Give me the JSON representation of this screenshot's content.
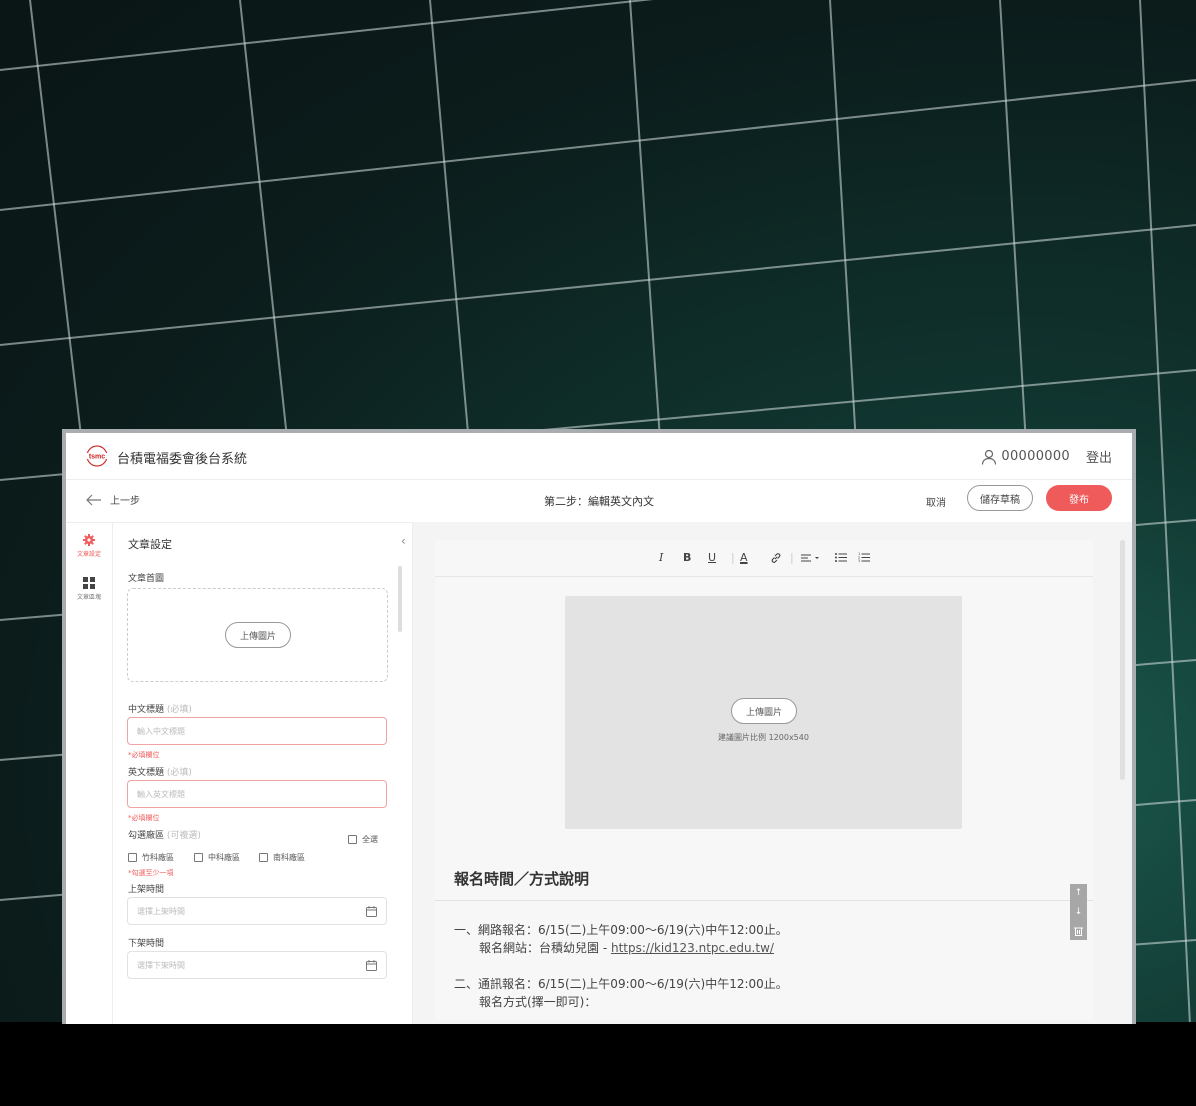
{
  "header": {
    "logo_text": "tsmc",
    "app_title": "台積電福委會後台系統",
    "user_id": "00000000",
    "logout": "登出"
  },
  "subbar": {
    "back": "上一步",
    "step_title": "第二步：編輯英文內文",
    "cancel": "取消",
    "save_draft": "儲存草稿",
    "publish": "發布"
  },
  "rail": {
    "items": [
      {
        "label": "文章設定",
        "icon": "gear-icon",
        "active": true
      },
      {
        "label": "文章區塊",
        "icon": "grid-icon",
        "active": false
      }
    ]
  },
  "panel": {
    "title": "文章設定",
    "cover_label": "文章首圖",
    "upload_btn": "上傳圖片",
    "zh_title_label": "中文標題",
    "required_tag": "(必填)",
    "zh_title_placeholder": "輸入中文標題",
    "required_error": "*必填欄位",
    "en_title_label": "英文標題",
    "en_title_placeholder": "輸入英文標題",
    "required_error_en": "*必填欄位",
    "area_label": "勾選廠區",
    "multi_tag": "(可複選)",
    "select_all": "全選",
    "areas": [
      "竹科廠區",
      "中科廠區",
      "南科廠區"
    ],
    "area_error": "*勾選至少一項",
    "publish_time_label": "上架時間",
    "publish_time_placeholder": "選擇上架時間",
    "unpublish_time_label": "下架時間",
    "unpublish_time_placeholder": "選擇下架時間"
  },
  "editor": {
    "toolbar": [
      "italic-icon",
      "bold-icon",
      "underline-icon",
      "font-color-icon",
      "link-icon",
      "align-icon",
      "bullet-list-icon",
      "numbered-list-icon"
    ],
    "image_upload_btn": "上傳圖片",
    "image_hint": "建議圖片比例 1200x540",
    "section_title": "報名時間／方式說明",
    "paragraphs": {
      "p1": "一、網路報名：6/15(二)上午09:00～6/19(六)中午12:00止。",
      "p2_prefix": "報名網站：台積幼兒園 - ",
      "p2_link": "https://kid123.ntpc.edu.tw/",
      "p3": "二、通訊報名：6/15(二)上午09:00～6/19(六)中午12:00止。",
      "p4": "報名方式(擇一即可)："
    }
  },
  "colors": {
    "accent": "#ef5a5a",
    "background_grid": "#0b1c1b"
  }
}
